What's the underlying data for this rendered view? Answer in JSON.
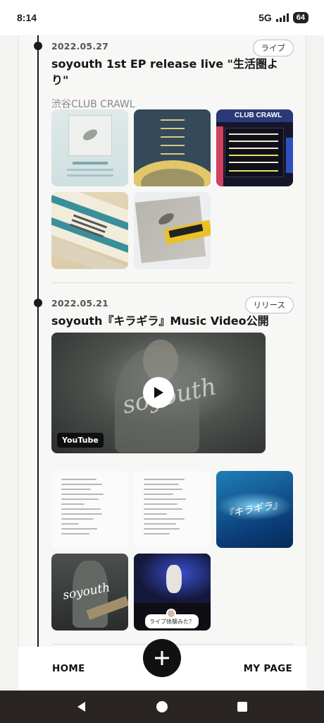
{
  "status_bar": {
    "time": "8:14",
    "network": "5G",
    "battery": "64"
  },
  "entries": [
    {
      "date": "2022.05.27",
      "tag": "ライブ",
      "title": "soyouth 1st EP release live \"生活圏より\"",
      "venue": "渋谷CLUB CRAWL",
      "images": [
        {
          "name": "flyer-image",
          "caption": ""
        },
        {
          "name": "lineup-image",
          "caption": ""
        },
        {
          "name": "club-crawl-board-image",
          "caption": "CLUB CRAWL"
        },
        {
          "name": "ticket-image",
          "caption": ""
        },
        {
          "name": "ep-cd-image",
          "caption": ""
        }
      ]
    },
    {
      "date": "2022.05.21",
      "tag": "リリース",
      "title": "soyouth『キラギラ』Music Video公開",
      "video": {
        "badge": "YouTube",
        "overlay_text": "soyouth"
      },
      "images": [
        {
          "name": "lyrics-image-1"
        },
        {
          "name": "lyrics-image-2"
        },
        {
          "name": "kiragira-blue-image",
          "caption": "『キラギラ』"
        },
        {
          "name": "band-photo-image",
          "caption": "soyouth"
        },
        {
          "name": "live-photo-image",
          "caption": "ライブ体験みた？"
        }
      ]
    }
  ],
  "bottom_nav": {
    "home": "HOME",
    "mypage": "MY PAGE"
  }
}
